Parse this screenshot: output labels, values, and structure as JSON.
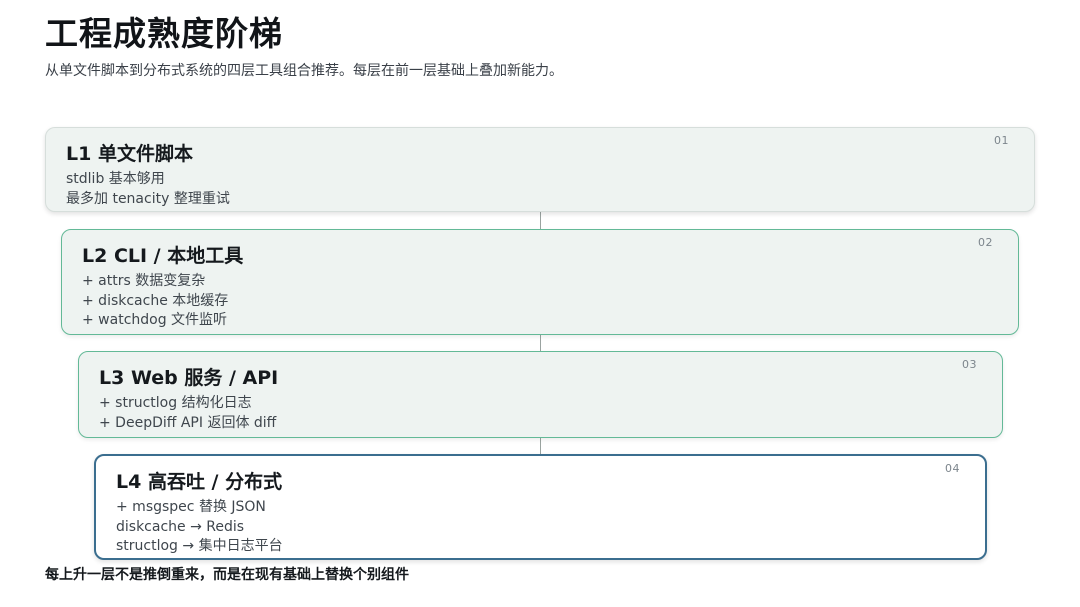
{
  "header": {
    "title": "工程成熟度阶梯",
    "subtitle": "从单文件脚本到分布式系统的四层工具组合推荐。每层在前一层基础上叠加新能力。"
  },
  "tiers": [
    {
      "number": "01",
      "title": "L1 单文件脚本",
      "lines": [
        "stdlib 基本够用",
        "最多加 tenacity 整理重试"
      ]
    },
    {
      "number": "02",
      "title": "L2 CLI / 本地工具",
      "lines": [
        "+ attrs 数据变复杂",
        "+ diskcache 本地缓存",
        "+ watchdog 文件监听"
      ]
    },
    {
      "number": "03",
      "title": "L3 Web 服务 / API",
      "lines": [
        "+ structlog 结构化日志",
        "+ DeepDiff API 返回体 diff"
      ]
    },
    {
      "number": "04",
      "title": "L4 高吞吐 / 分布式",
      "lines": [
        "+ msgspec 替换 JSON",
        "diskcache → Redis",
        "structlog → 集中日志平台"
      ]
    }
  ],
  "footer": {
    "note": "每上升一层不是推倒重来，而是在现有基础上替换个别组件"
  },
  "colors": {
    "tier_fill": "#eef3f1",
    "tier_border_green": "#63b997",
    "tier_border_blue": "#3b6e8f",
    "connector": "#9aa3a0"
  }
}
